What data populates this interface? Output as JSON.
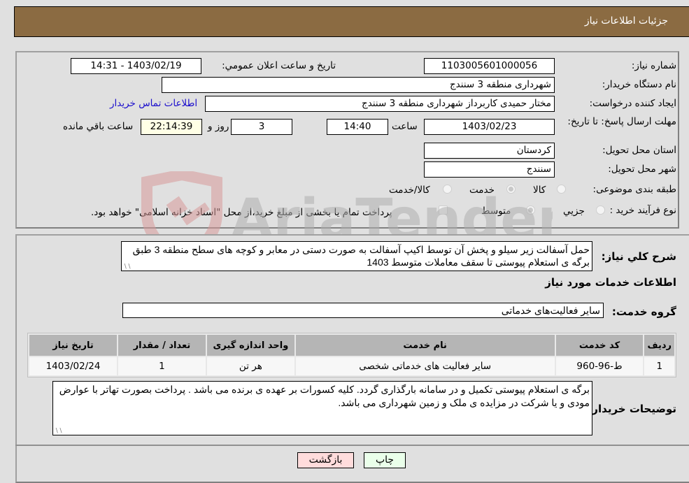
{
  "header": {
    "title": "جزئیات اطلاعات نیاز"
  },
  "need_info": {
    "need_number_label": "شماره نیاز:",
    "need_number": "1103005601000056",
    "announce_label": "تاريخ و ساعت اعلان عمومي:",
    "announce_value": "1403/02/19 - 14:31",
    "buyer_org_label": "نام دستگاه خریدار:",
    "buyer_org": "شهرداری منطقه 3 سنندج",
    "creator_label": "ایجاد کننده درخواست:",
    "creator": "مختار حمیدی کاربرداز شهرداری منطقه 3 سنندج",
    "contact_link": "اطلاعات تماس خریدار",
    "deadline_label": "مهلت ارسال پاسخ: تا تاریخ:",
    "deadline_date": "1403/02/23",
    "time_label": "ساعت",
    "deadline_time": "14:40",
    "days_value": "3",
    "days_label": "روز و",
    "remaining_time": "22:14:39",
    "remaining_label": "ساعت باقي مانده",
    "province_label": "استان محل تحویل:",
    "province": "کردستان",
    "city_label": "شهر محل تحویل:",
    "city": "سنندج",
    "category_label": "طبقه بندی موضوعی:",
    "category_options": [
      {
        "label": "کالا",
        "checked": false
      },
      {
        "label": "خدمت",
        "checked": true
      },
      {
        "label": "کالا/خدمت",
        "checked": false
      }
    ],
    "process_label": "نوع فرآیند خرید :",
    "process_options": [
      {
        "label": "جزيي",
        "checked": false
      },
      {
        "label": "متوسط",
        "checked": true
      }
    ],
    "treasury_checkbox_label": "پرداخت تمام یا بخشی از مبلغ خرید،از محل \"اسناد خزانه اسلامی\" خواهد بود."
  },
  "description": {
    "label": "شرح كلي نياز:",
    "text": "حمل آسفالت زیر سیلو و پخش آن توسط اکیپ آسفالت به صورت دستی در معابر و کوچه های سطح منطقه 3 طبق برگه ی استعلام پیوستی تا سقف معاملات متوسط 1403"
  },
  "services": {
    "section_title": "اطلاعات خدمات مورد نیاز",
    "group_label": "گروه خدمت:",
    "group_value": "سایر فعالیت‌های خدماتی",
    "table": {
      "headers": [
        "ردیف",
        "کد خدمت",
        "نام خدمت",
        "واحد اندازه گیری",
        "تعداد / مقدار",
        "تاریخ نیاز"
      ],
      "rows": [
        [
          "1",
          "ط-96-960",
          "سایر فعالیت های خدماتی شخصی",
          "هر تن",
          "1",
          "1403/02/24"
        ]
      ]
    }
  },
  "buyer_notes": {
    "label": "توضیحات خریدار:",
    "text": "برگه ی استعلام پیوستی تکمیل و در سامانه بارگذاری گردد. کلیه کسورات بر عهده ی برنده می باشد . پرداخت بصورت تهاتر با عوارض مودی و یا شرکت در مزایده ی ملک و زمین شهرداری می باشد."
  },
  "actions": {
    "print_label": "چاپ",
    "back_label": "بازگشت"
  },
  "watermark": {
    "text": "AriaTender.neT"
  }
}
